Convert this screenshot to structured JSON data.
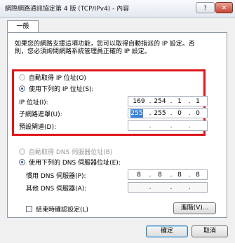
{
  "window": {
    "title": "網際網路通訊協定第 4 版 (TCP/IPv4) - 內容",
    "help_label": "?",
    "close_label": "✕"
  },
  "tab": {
    "label": "一般"
  },
  "description": {
    "line1": "如果您的網路支援這項功能，您可以取得自動指派的 IP 設定。否",
    "line2": "則，您必須詢問網路系統管理員正確的 IP 設定。"
  },
  "ip_section": {
    "auto_label": "自動取得 IP 位址(O)",
    "manual_label": "使用下列的 IP 位址(S):",
    "ip_label": "IP 位址(I):",
    "mask_label": "子網路遮罩(U):",
    "gateway_label": "預設閘道(D):",
    "ip_address": [
      "169",
      "254",
      "1",
      "1"
    ],
    "subnet_mask": [
      "255",
      "255",
      "0",
      "0"
    ],
    "gateway": [
      "",
      "",
      "",
      ""
    ]
  },
  "dns_section": {
    "auto_label": "自動取得 DNS 伺服器位址(B)",
    "manual_label": "使用下列的 DNS 伺服器位址(E):",
    "preferred_label": "慣用 DNS 伺服器(P):",
    "alternate_label": "其他 DNS 伺服器(A):",
    "preferred": [
      "8",
      "8",
      "8",
      "8"
    ],
    "alternate": [
      "",
      "",
      "",
      ""
    ]
  },
  "validate": {
    "label": "結束時確認設定(L)"
  },
  "buttons": {
    "advanced": "進階(V)...",
    "ok": "確定",
    "cancel": "取消"
  },
  "colors": {
    "highlight_box": "#e0161c",
    "selection": "#3b84d9"
  }
}
